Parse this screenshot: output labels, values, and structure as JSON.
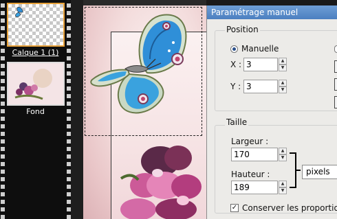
{
  "layers": {
    "items": [
      {
        "label": "Calque 1 (1)",
        "selected": true
      },
      {
        "label": "Fond",
        "selected": false
      }
    ]
  },
  "dialog": {
    "title": "Paramétrage manuel",
    "position": {
      "group_label": "Position",
      "mode_label": "Manuelle",
      "mode_selected": true,
      "x_label": "X :",
      "x_value": "3",
      "y_label": "Y :",
      "y_value": "3"
    },
    "size": {
      "group_label": "Taille",
      "width_label": "Largeur :",
      "width_value": "170",
      "height_label": "Hauteur :",
      "height_value": "189",
      "units_value": "pixels",
      "keep_ratio_label": "Conserver les proportions",
      "keep_ratio_checked": true
    }
  },
  "colors": {
    "selected_layer_border": "#e8a23a",
    "titlebar": "#4b7fc0",
    "butterfly_wing": "#2f8fd8"
  }
}
